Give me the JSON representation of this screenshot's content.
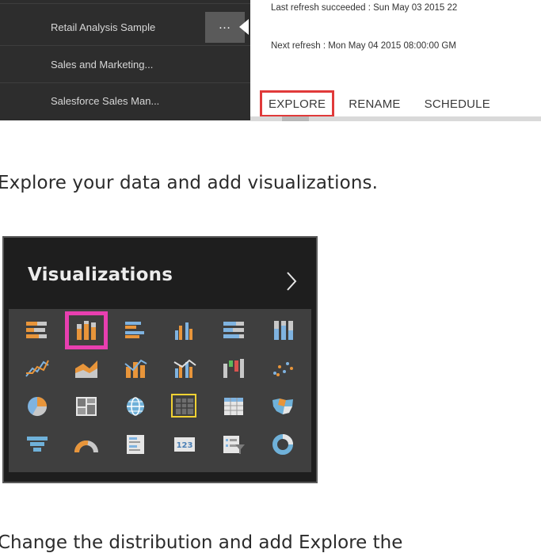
{
  "nav": {
    "items": [
      {
        "label": "Retail Analysis Sample"
      },
      {
        "label": "Sales and Marketing..."
      },
      {
        "label": "Salesforce Sales Man..."
      }
    ],
    "more_label": "…"
  },
  "refresh_popup": {
    "last_refresh": "Last refresh succeeded : Sun May 03 2015 22",
    "next_refresh": "Next refresh : Mon May 04 2015 08:00:00 GM",
    "actions": {
      "explore": "EXPLORE",
      "rename": "RENAME",
      "schedule": "SCHEDULE"
    },
    "highlight_color": "#e03a3a"
  },
  "caption": "Explore your data and add visualizations.",
  "caption_cut": "Change the distribution and add Explore the",
  "visualizations": {
    "title": "Visualizations",
    "chevron_icon": "chevron-right-icon",
    "selection_color": "#e83fb0",
    "focus_color": "#f2d233",
    "icons": [
      "stacked-bar-chart-icon",
      "stacked-column-chart-icon",
      "clustered-bar-chart-icon",
      "clustered-column-chart-icon",
      "100-percent-stacked-bar-chart-icon",
      "100-percent-stacked-column-chart-icon",
      "line-chart-icon",
      "area-chart-icon",
      "line-and-stacked-column-chart-icon",
      "line-and-clustered-column-chart-icon",
      "waterfall-chart-icon",
      "scatter-chart-icon",
      "pie-chart-icon",
      "treemap-icon",
      "map-icon",
      "table-icon",
      "matrix-icon",
      "filled-map-icon",
      "funnel-icon",
      "gauge-icon",
      "multi-row-card-icon",
      "card-icon",
      "slicer-icon",
      "donut-chart-icon"
    ]
  }
}
